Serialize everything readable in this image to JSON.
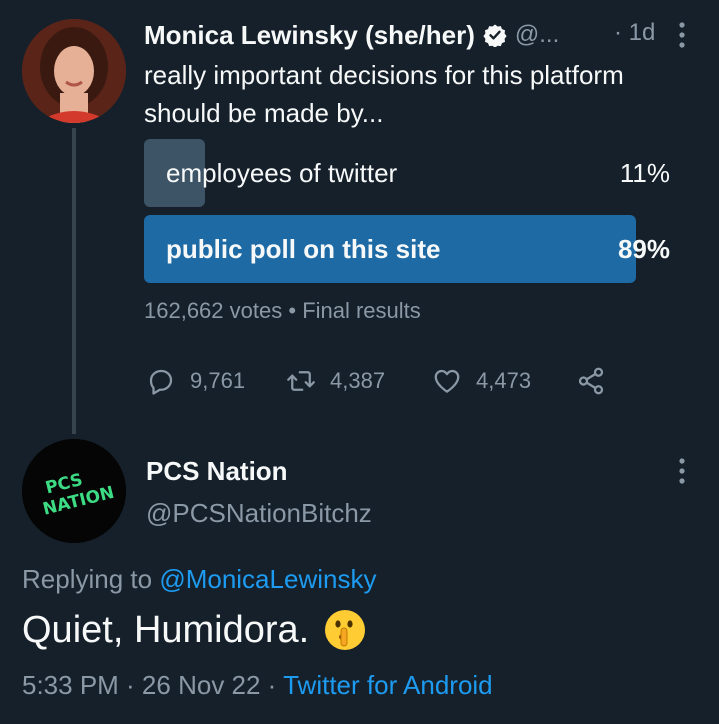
{
  "tweet1": {
    "author_name": "Monica Lewinsky (she/her)",
    "handle": "@...",
    "time": "· 1d",
    "text": "really important decisions for this platform should be made by...",
    "poll": {
      "options": [
        {
          "label": "employees of twitter",
          "percent_text": "11%",
          "percent": 11
        },
        {
          "label": "public poll on this site",
          "percent_text": "89%",
          "percent": 89
        }
      ],
      "votes": "162,662 votes",
      "separator": "•",
      "status": "Final results"
    },
    "actions": {
      "replies": "9,761",
      "retweets": "4,387",
      "likes": "4,473"
    }
  },
  "tweet2": {
    "author_name": "PCS Nation",
    "handle": "@PCSNationBitchz",
    "replying_prefix": "Replying to",
    "replying_to": "@MonicaLewinsky",
    "text": "Quiet, Humidora.",
    "time_date": "5:33 PM · 26 Nov 22 ·",
    "source": "Twitter for Android"
  },
  "logo_text": "PCS NATION",
  "icons": {
    "verified": "verified-badge-icon",
    "more": "more-vertical-icon",
    "reply": "reply-icon",
    "retweet": "retweet-icon",
    "like": "heart-icon",
    "share": "share-icon",
    "emoji": "shushing-face-emoji"
  },
  "colors": {
    "background": "#15202b",
    "text": "#f7f9f9",
    "muted": "#8b98a5",
    "link": "#1d9bf0",
    "poll_winner": "#1d6aa5",
    "poll_loser": "#3d5466",
    "logo_green": "#3ddc84"
  }
}
